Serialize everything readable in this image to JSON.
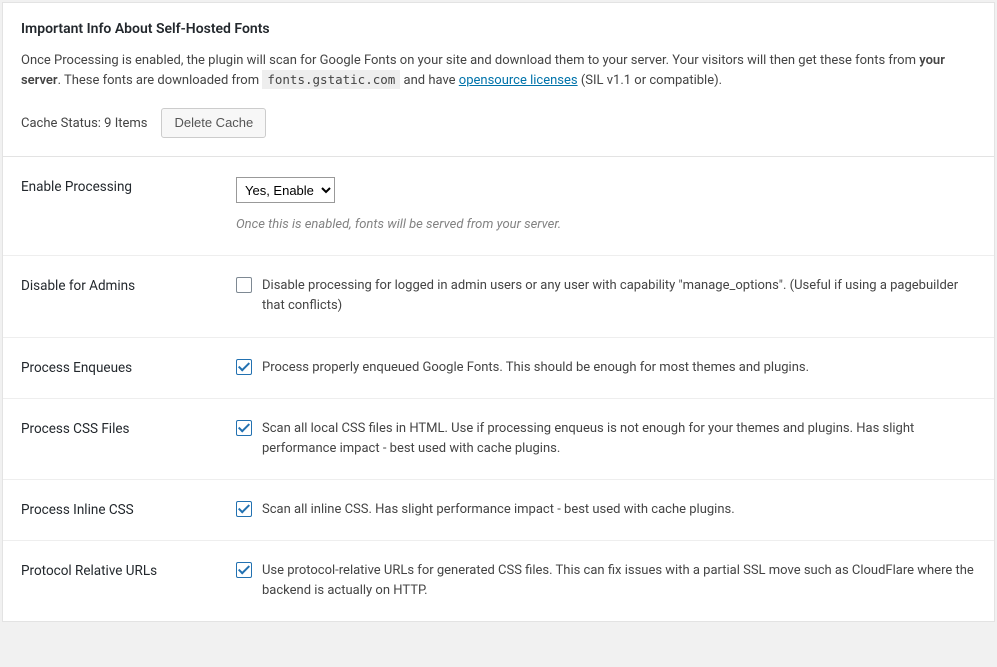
{
  "info": {
    "title": "Important Info About Self-Hosted Fonts",
    "desc_pre": "Once Processing is enabled, the plugin will scan for Google Fonts on your site and download them to your server. Your visitors will then get these fonts from ",
    "desc_bold": "your server",
    "desc_mid": ". These fonts are downloaded from ",
    "desc_code": "fonts.gstatic.com",
    "desc_mid2": " and have ",
    "desc_link": "opensource licenses",
    "desc_post": " (SIL v1.1 or compatible).",
    "cache_status": "Cache Status: 9 Items",
    "delete_cache": "Delete Cache"
  },
  "settings": {
    "enable_processing": {
      "label": "Enable Processing",
      "value": "Yes, Enable",
      "helper": "Once this is enabled, fonts will be served from your server."
    },
    "disable_admins": {
      "label": "Disable for Admins",
      "checked": false,
      "desc": "Disable processing for logged in admin users or any user with capability \"manage_options\". (Useful if using a pagebuilder that conflicts)"
    },
    "process_enqueues": {
      "label": "Process Enqueues",
      "checked": true,
      "desc": "Process properly enqueued Google Fonts. This should be enough for most themes and plugins."
    },
    "process_css_files": {
      "label": "Process CSS Files",
      "checked": true,
      "desc": "Scan all local CSS files in HTML. Use if processing enqueus is not enough for your themes and plugins. Has slight performance impact - best used with cache plugins."
    },
    "process_inline_css": {
      "label": "Process Inline CSS",
      "checked": true,
      "desc": "Scan all inline CSS. Has slight performance impact - best used with cache plugins."
    },
    "protocol_relative": {
      "label": "Protocol Relative URLs",
      "checked": true,
      "desc": "Use protocol-relative URLs for generated CSS files. This can fix issues with a partial SSL move such as CloudFlare where the backend is actually on HTTP."
    }
  }
}
